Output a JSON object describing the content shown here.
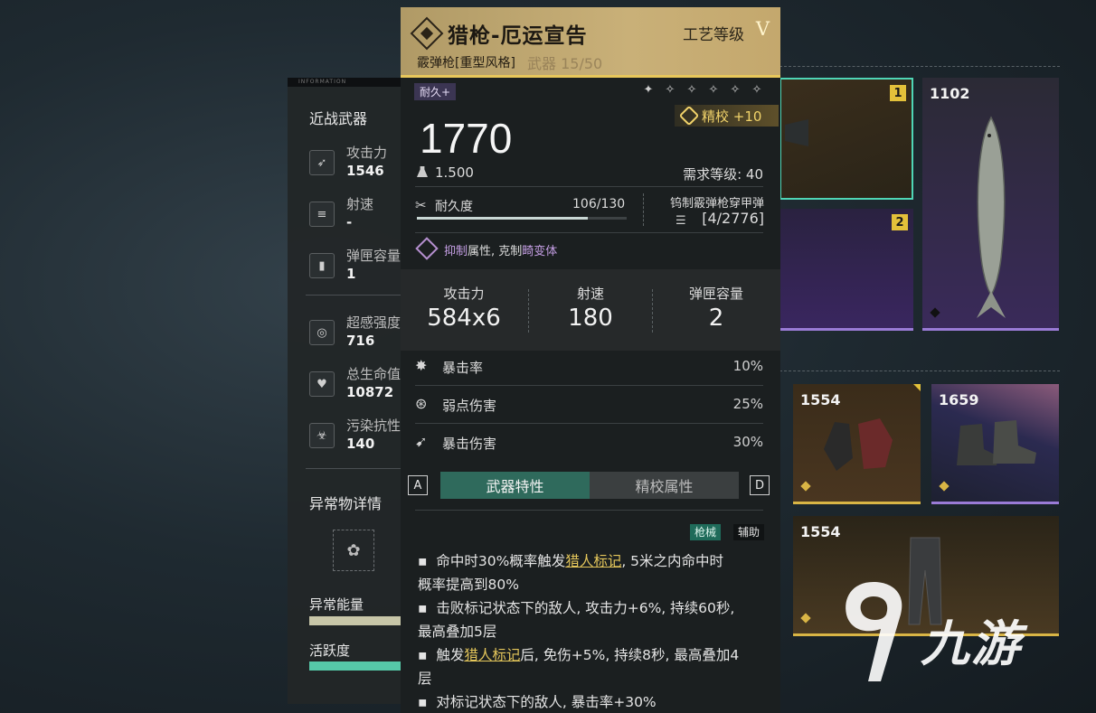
{
  "left_panel": {
    "melee_title": "近战武器",
    "stats": [
      {
        "icon": "attack-icon",
        "label": "攻击力",
        "value": "1546"
      },
      {
        "icon": "fire-rate-icon",
        "label": "射速",
        "value": "-"
      },
      {
        "icon": "magazine-icon",
        "label": "弹匣容量",
        "value": "1"
      },
      {
        "icon": "psi-intensity-icon",
        "label": "超感强度",
        "value": "716"
      },
      {
        "icon": "health-icon",
        "label": "总生命值",
        "value": "10872"
      },
      {
        "icon": "contamination-icon",
        "label": "污染抗性",
        "value": "140"
      }
    ],
    "anomaly_title": "异常物详情",
    "anomaly_energy_label": "异常能量",
    "activity_label": "活跃度",
    "colors": {
      "energy_bar": "#c8c6a8",
      "activity_bar": "#56c9a9"
    }
  },
  "tooltip": {
    "name": "猎枪-厄运宣告",
    "craft_level": "工艺等级",
    "craft_roman": "V",
    "type": "霰弹枪[重型风格]",
    "ghost_text": "武器 15/50",
    "durability_tag": "耐久+",
    "stars": [
      "✦",
      "✧",
      "✧",
      "✧",
      "✧",
      "✧"
    ],
    "refine": "精校 +10",
    "power": "1770",
    "weight": "1.500",
    "required_level": "需求等级: 40",
    "durability_label": "耐久度",
    "durability_value": "106/130",
    "durability_fraction": 0.815,
    "ammo_name": "钨制霰弹枪穿甲弹",
    "ammo_count": "[4/2776]",
    "trait_prefix": "抑制",
    "trait_mid": "属性, 克制",
    "trait_suffix": "畸变体",
    "big_stats": [
      {
        "label": "攻击力",
        "value": "584x6"
      },
      {
        "label": "射速",
        "value": "180"
      },
      {
        "label": "弹匣容量",
        "value": "2"
      }
    ],
    "sub_stats": [
      {
        "icon": "crit-rate-icon",
        "label": "暴击率",
        "value": "10%"
      },
      {
        "icon": "weakspot-icon",
        "label": "弱点伤害",
        "value": "25%"
      },
      {
        "icon": "crit-damage-icon",
        "label": "暴击伤害",
        "value": "30%"
      }
    ],
    "key_left": "A",
    "key_right": "D",
    "tabs": [
      "武器特性",
      "精校属性"
    ],
    "tags": [
      "枪械",
      "辅助"
    ],
    "desc": [
      {
        "pre": "命中时30%概率触发",
        "hl": "猎人标记",
        "post": ", 5米之内命中时"
      },
      {
        "pre": "概率提高到80%",
        "hl": "",
        "post": ""
      },
      {
        "pre": "击败标记状态下的敌人, 攻击力+6%, 持续60秒,",
        "hl": "",
        "post": ""
      },
      {
        "pre": "最高叠加5层",
        "hl": "",
        "post": ""
      },
      {
        "pre": "触发",
        "hl": "猎人标记",
        "post": "后, 免伤+5%, 持续8秒, 最高叠加4"
      },
      {
        "pre": "层",
        "hl": "",
        "post": ""
      },
      {
        "pre": "对标记状态下的敌人, 暴击率+30%",
        "hl": "",
        "post": ""
      }
    ],
    "colors": {
      "header_gold": "#c9b078",
      "accent_gold": "#e8c75b",
      "tab_active": "#2f6a5c",
      "trait_purple": "#c49ee3"
    }
  },
  "inventory": {
    "slots": [
      {
        "id": "slot-gun-1",
        "number": "",
        "badge": "1"
      },
      {
        "id": "slot-gun-2",
        "number": "",
        "badge": "2"
      },
      {
        "id": "slot-fish",
        "number": "1102",
        "badge": ""
      },
      {
        "id": "slot-gloves",
        "number": "1554",
        "badge": ""
      },
      {
        "id": "slot-boots",
        "number": "1659",
        "badge": ""
      },
      {
        "id": "slot-pants",
        "number": "1554",
        "badge": ""
      }
    ]
  },
  "watermark": {
    "text": "九游"
  }
}
